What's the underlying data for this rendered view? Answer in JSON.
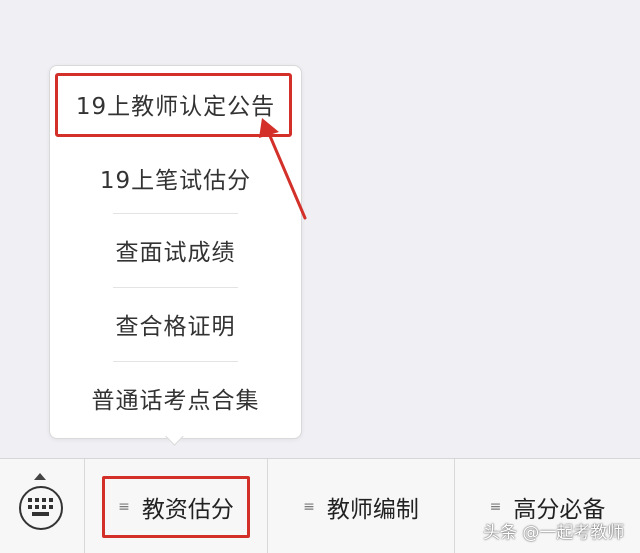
{
  "submenu": {
    "items": [
      {
        "label": "19上教师认定公告"
      },
      {
        "label": "19上笔试估分"
      },
      {
        "label": "查面试成绩"
      },
      {
        "label": "查合格证明"
      },
      {
        "label": "普通话考点合集"
      }
    ]
  },
  "bottom_bar": {
    "keyboard_icon": "keyboard-icon",
    "tabs": [
      {
        "menu_icon": "≡",
        "label": "教资估分"
      },
      {
        "menu_icon": "≡",
        "label": "教师编制"
      },
      {
        "menu_icon": "≡",
        "label": "高分必备"
      }
    ]
  },
  "annotation_color": "#d3302a",
  "watermark": "头条 @一起考教师"
}
